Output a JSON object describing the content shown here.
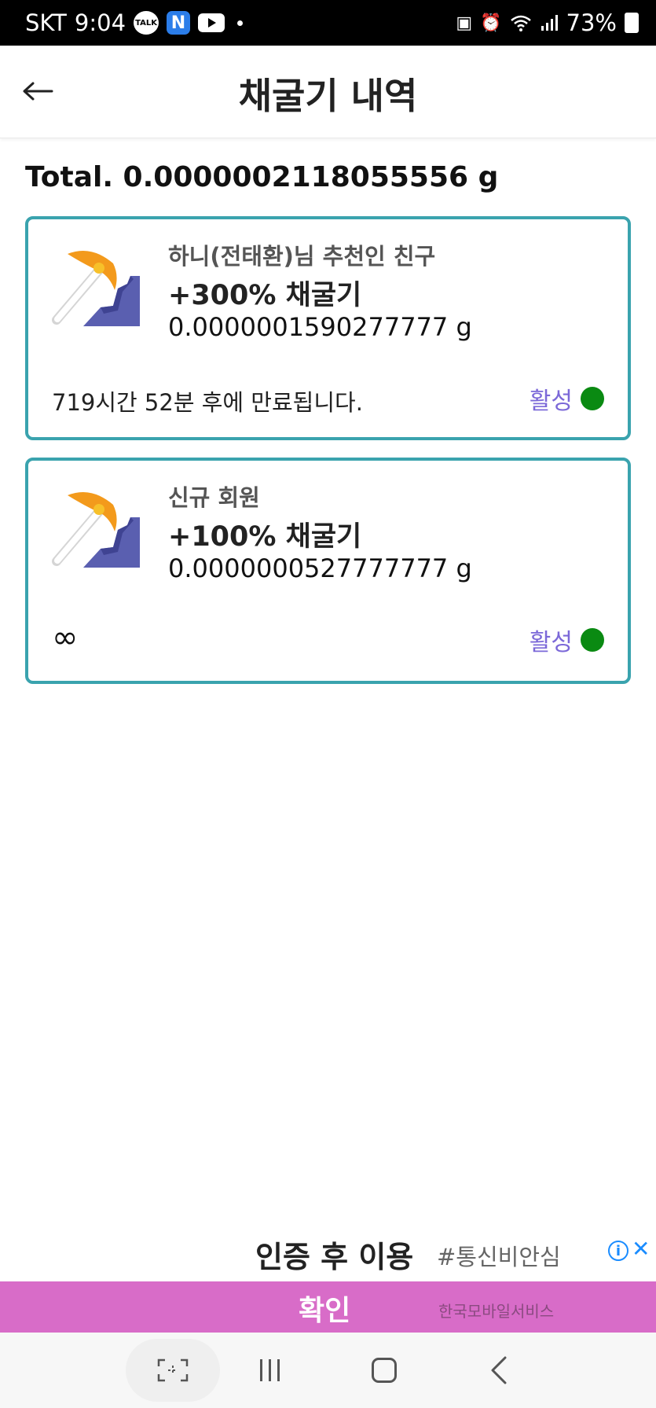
{
  "status_bar": {
    "carrier": "SKT",
    "time": "9:04",
    "talk_badge": "TALK",
    "n_badge": "N",
    "battery": "73%"
  },
  "header": {
    "title": "채굴기 내역",
    "back_icon": "arrow-left-icon"
  },
  "total": "Total. 0.0000002118055556 g",
  "miners": [
    {
      "subtitle": "하니(전태환)님 추천인 친구",
      "boost": "+300% 채굴기",
      "amount": "0.0000001590277777 g",
      "expiry": "719시간 52분 후에 만료됩니다.",
      "status": "활성"
    },
    {
      "subtitle": "신규 회원",
      "boost": "+100% 채굴기",
      "amount": "0.0000000527777777 g",
      "expiry": "∞",
      "status": "활성"
    }
  ],
  "ad": {
    "headline": "인증 후 이용",
    "hashtag": "#통신비안심",
    "cta": "확인",
    "brand": "한국모바일서비스"
  },
  "colors": {
    "card_border": "#3aa3ae",
    "status_label": "#7b68d8",
    "status_dot": "#0a8a12",
    "ad_cta": "#d86cc8"
  }
}
